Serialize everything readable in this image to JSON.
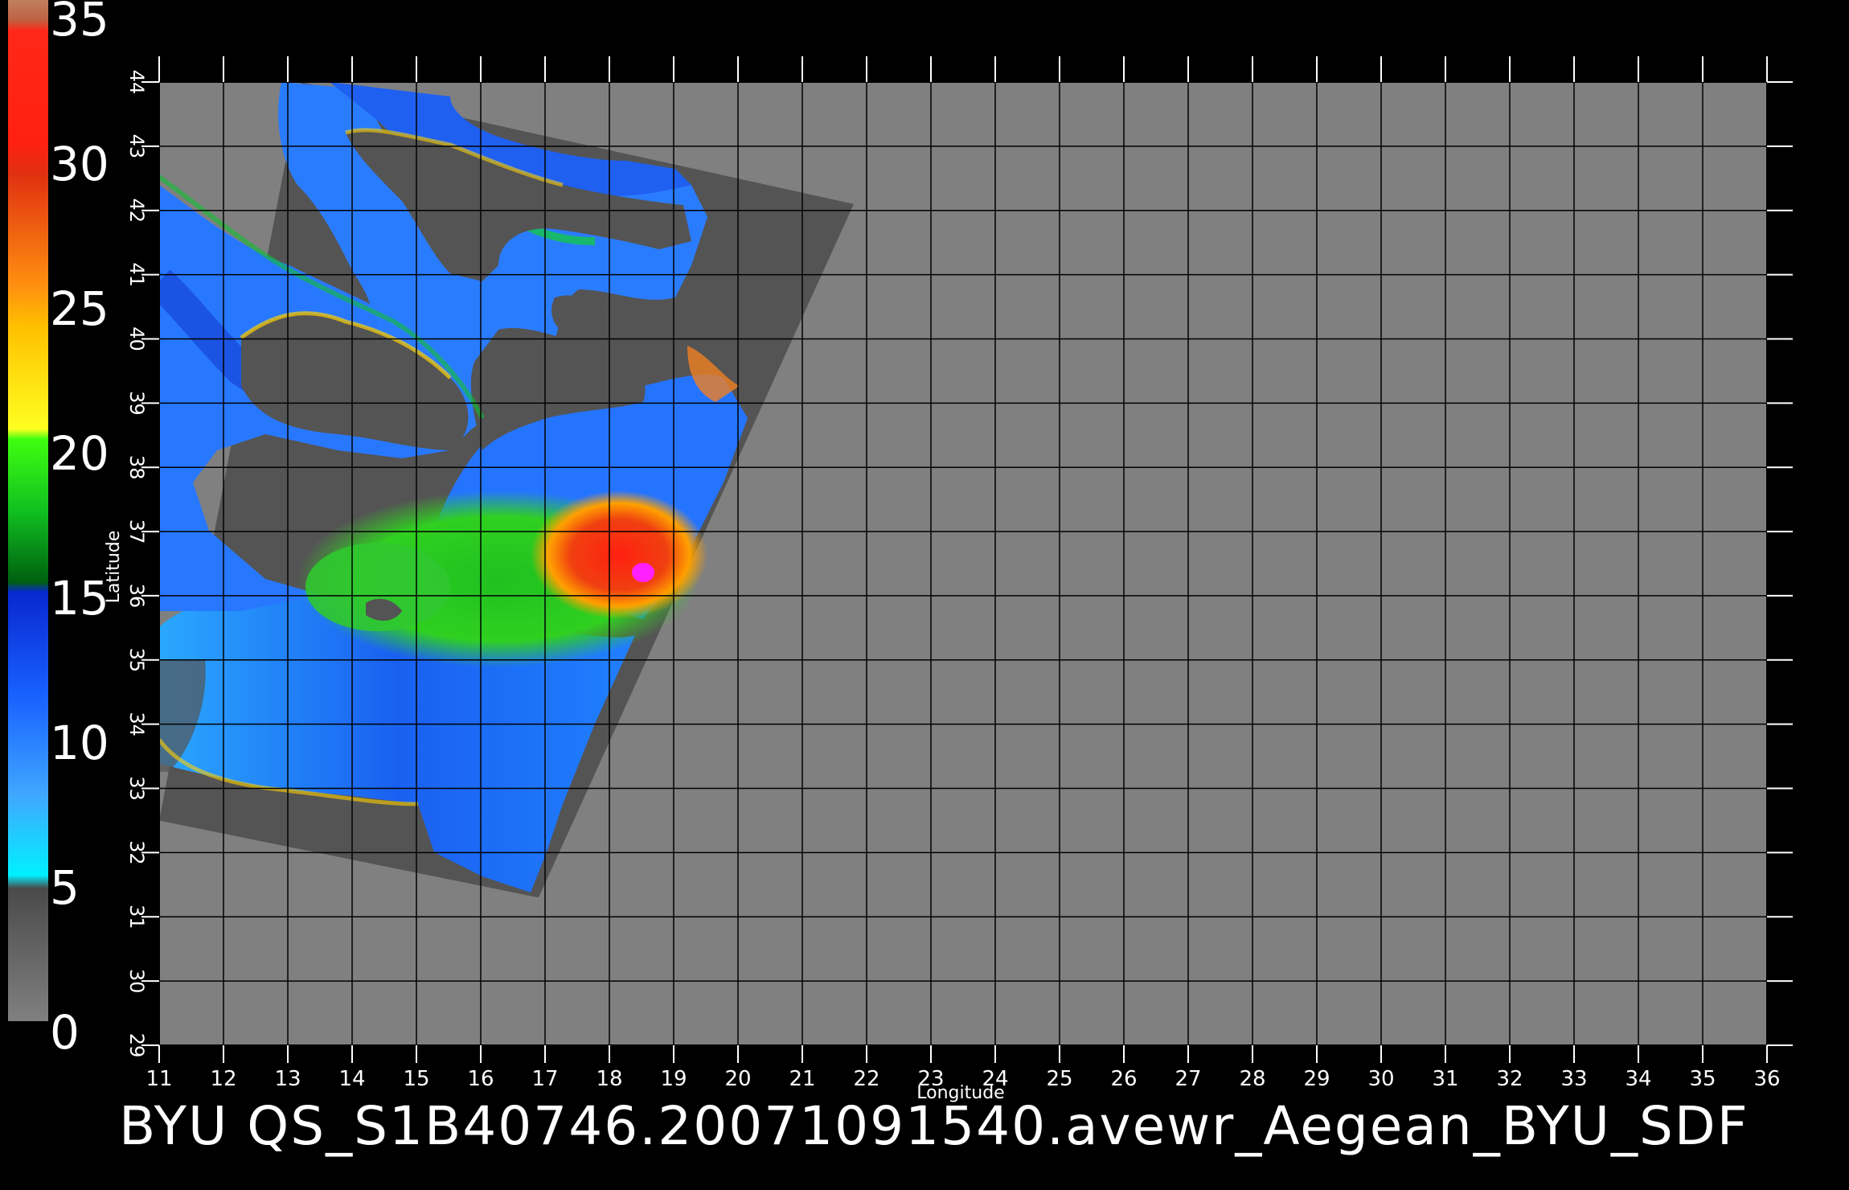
{
  "map": {
    "x_axis_label": "Longitude",
    "y_axis_label": "Latitude",
    "x_ticks": [
      "11",
      "12",
      "13",
      "14",
      "15",
      "16",
      "17",
      "18",
      "19",
      "20",
      "21",
      "22",
      "23",
      "24",
      "25",
      "26",
      "27",
      "28",
      "29",
      "30",
      "31",
      "32",
      "33",
      "34",
      "35",
      "36"
    ],
    "y_ticks": [
      "29",
      "30",
      "31",
      "32",
      "33",
      "34",
      "35",
      "36",
      "37",
      "38",
      "39",
      "40",
      "41",
      "42",
      "43",
      "44"
    ],
    "lon_range": [
      11,
      36
    ],
    "lat_range": [
      29,
      44
    ],
    "swath_polygon": [
      [
        11,
        32.5
      ],
      [
        13.2,
        44
      ],
      [
        21.8,
        42.1
      ],
      [
        16.9,
        31.3
      ]
    ],
    "colors": {
      "background": "#000000",
      "plot_background": "#808080",
      "swath_land": "#545454",
      "grid": "#000000"
    }
  },
  "colorbar": {
    "labels": [
      "0",
      "5",
      "10",
      "15",
      "20",
      "25",
      "30",
      "35"
    ],
    "range": [
      0,
      35
    ],
    "segments": [
      {
        "from": 0,
        "to": 5,
        "color": "#666666"
      },
      {
        "from": 5,
        "to": 10,
        "color": "#3aa0ff"
      },
      {
        "from": 10,
        "to": 15,
        "color": "#1550e0"
      },
      {
        "from": 15,
        "to": 20,
        "color": "#10b020"
      },
      {
        "from": 20,
        "to": 25,
        "color": "#ffd000"
      },
      {
        "from": 25,
        "to": 30,
        "color": "#f07010"
      },
      {
        "from": 30,
        "to": 35,
        "color": "#f02010"
      }
    ]
  },
  "footer": {
    "title": "BYU  QS_S1B40746.20071091540.avewr_Aegean_BYU_SDF"
  }
}
